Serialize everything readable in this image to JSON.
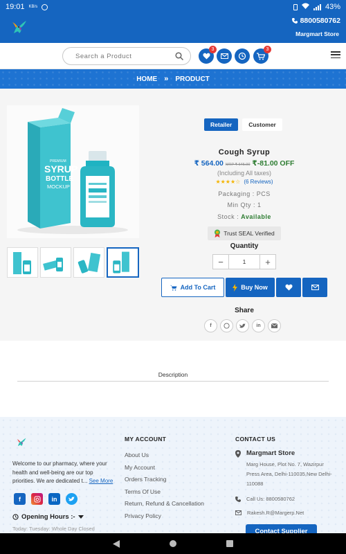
{
  "status_bar": {
    "time": "19:01",
    "kb_label": "KB/s",
    "battery": "43%"
  },
  "header": {
    "phone": "8800580762",
    "store_name": "Margmart Store"
  },
  "search": {
    "placeholder": "Search a Product"
  },
  "header_badges": {
    "wishlist_count": "3",
    "cart_count": "3"
  },
  "breadcrumb": {
    "home": "HOME",
    "current": "PRODUCT"
  },
  "product": {
    "tabs": [
      "Retailer",
      "Customer"
    ],
    "active_tab": "Retailer",
    "title": "Cough Syrup",
    "price": "₹ 564.00",
    "mrp": "MRP ₹ 645.00",
    "discount": "₹-81.00 OFF",
    "taxes": "(Including All taxes)",
    "rating": 4,
    "rating_stars": "★★★★☆",
    "reviews": "(6 Reviews)",
    "packaging_label": "Packaging :",
    "packaging_value": "PCS",
    "min_qty_label": "Min Qty :",
    "min_qty_value": "1",
    "stock_label": "Stock :",
    "stock_value": "Available",
    "seal": "Trust SEAL Verified",
    "quantity_label": "Quantity",
    "quantity_value": "1",
    "add_to_cart": "Add To Cart",
    "buy_now": "Buy Now",
    "share_label": "Share",
    "box_text": {
      "line1": "PREMIUM",
      "line2": "SYRUP",
      "line3": "BOTTLE",
      "line4": "MOCKUP"
    }
  },
  "share_icons": [
    "facebook-icon",
    "whatsapp-icon",
    "twitter-icon",
    "linkedin-icon",
    "email-icon"
  ],
  "description_tab": "Description",
  "footer": {
    "welcome_text": "Welcome to our pharmacy, where your health and well-being are our top priorities. We are dedicated t...",
    "see_more": "See More",
    "opening_hours": "Opening Hours :-",
    "today": "Today: Tuesday: Whole Day Closed",
    "account_heading": "MY ACCOUNT",
    "account_links": [
      "About Us",
      "My Account",
      "Orders Tracking",
      "Terms Of Use",
      "Return, Refund & Cancellation",
      "Privacy Policy"
    ],
    "contact_heading": "CONTACT US",
    "contact_store": "Margmart Store",
    "address": "Marg House, Plot No. 7, Wazirpur Press Area, Delhi-110035,New Delhi-110088",
    "call": "Call Us: 8800580762",
    "email": "Rakesh.R@Margerp.Net",
    "contact_supplier": "Contact Supplier"
  },
  "colors": {
    "primary": "#1565c0",
    "discount": "#2e7d32",
    "badge": "#e53935",
    "star": "#f4b400"
  }
}
